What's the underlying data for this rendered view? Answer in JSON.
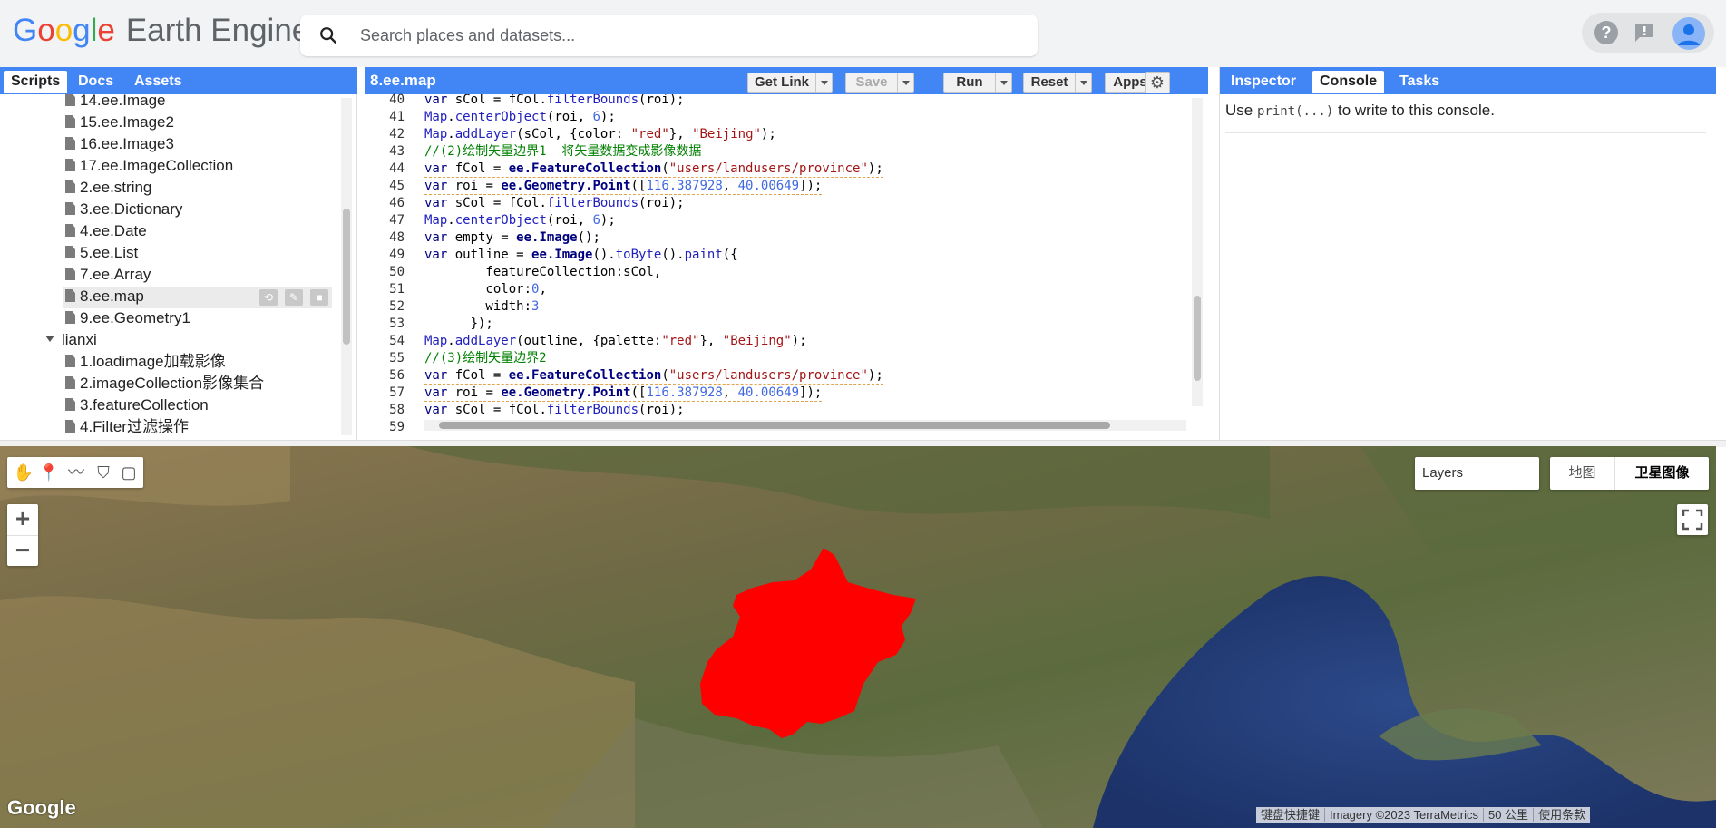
{
  "header": {
    "logo": {
      "g1": "G",
      "g2": "o",
      "g3": "o",
      "g4": "g",
      "g5": "l",
      "g6": "e",
      "rest": "Earth Engine"
    },
    "search_placeholder": "Search places and datasets...",
    "icons": [
      "help-icon",
      "feedback-icon",
      "account-avatar-icon"
    ]
  },
  "left_panel": {
    "tabs": [
      "Scripts",
      "Docs",
      "Assets"
    ],
    "active_tab": "Scripts",
    "files": [
      "14.ee.Image",
      "15.ee.Image2",
      "16.ee.Image3",
      "17.ee.ImageCollection",
      "2.ee.string",
      "3.ee.Dictionary",
      "4.ee.Date",
      "5.ee.List",
      "7.ee.Array",
      "8.ee.map",
      "9.ee.Geometry1"
    ],
    "selected_file": "8.ee.map",
    "folder": "lianxi",
    "folder_files": [
      "1.loadimage加载影像",
      "2.imageCollection影像集合",
      "3.featureCollection",
      "4.Filter过滤操作"
    ]
  },
  "editor": {
    "title": "8.ee.map",
    "buttons": {
      "get_link": "Get Link",
      "save": "Save",
      "run": "Run",
      "reset": "Reset",
      "apps": "Apps"
    },
    "line_numbers": [
      "40",
      "41",
      "42",
      "43",
      "44",
      "45",
      "46",
      "47",
      "48",
      "49",
      "50",
      "51",
      "52",
      "53",
      "54",
      "55",
      "56",
      "57",
      "58",
      "59"
    ]
  },
  "right_panel": {
    "tabs": [
      "Inspector",
      "Console",
      "Tasks"
    ],
    "active_tab": "Console",
    "console_prefix": "Use",
    "console_code": "print(...)",
    "console_suffix": "to write to this console."
  },
  "map": {
    "layers_label": "Layers",
    "map_type_options": [
      "地图",
      "卫星图像"
    ],
    "selected_map_type": "卫星图像",
    "watermark": "Google",
    "attribution": [
      "键盘快捷键",
      "Imagery ©2023 TerraMetrics",
      "50 公里",
      "使用条款"
    ],
    "zoom_in": "+",
    "zoom_out": "−",
    "region_color": "#ff0000"
  },
  "colors": {
    "accent": "#4285f4",
    "region": "#ff0000"
  }
}
